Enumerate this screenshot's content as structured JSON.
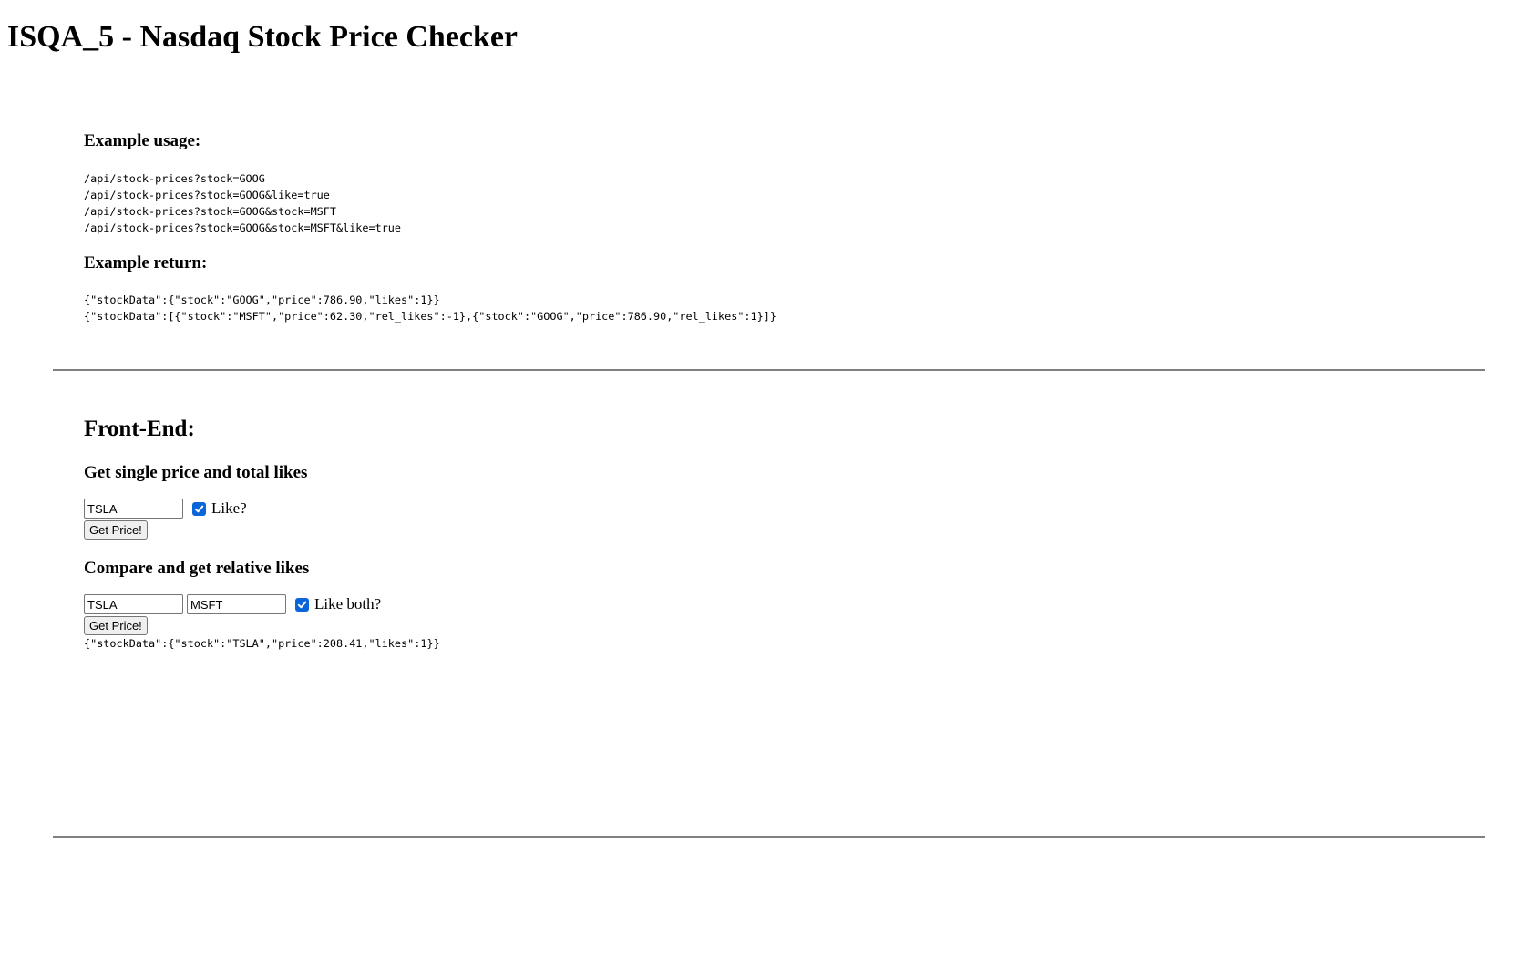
{
  "title": "ISQA_5 - Nasdaq Stock Price Checker",
  "usage": {
    "heading": "Example usage:",
    "lines": [
      "/api/stock-prices?stock=GOOG",
      "/api/stock-prices?stock=GOOG&like=true",
      "/api/stock-prices?stock=GOOG&stock=MSFT",
      "/api/stock-prices?stock=GOOG&stock=MSFT&like=true"
    ]
  },
  "return": {
    "heading": "Example return:",
    "lines": [
      "{\"stockData\":{\"stock\":\"GOOG\",\"price\":786.90,\"likes\":1}}",
      "{\"stockData\":[{\"stock\":\"MSFT\",\"price\":62.30,\"rel_likes\":-1},{\"stock\":\"GOOG\",\"price\":786.90,\"rel_likes\":1}]}"
    ]
  },
  "frontend": {
    "heading": "Front-End:",
    "single": {
      "heading": "Get single price and total likes",
      "stock_value": "TSLA",
      "like_checked": true,
      "like_label": "Like?",
      "button_label": "Get Price!"
    },
    "compare": {
      "heading": "Compare and get relative likes",
      "stock1_value": "TSLA",
      "stock2_value": "MSFT",
      "like_checked": true,
      "like_label": "Like both?",
      "button_label": "Get Price!"
    },
    "result": "{\"stockData\":{\"stock\":\"TSLA\",\"price\":208.41,\"likes\":1}}"
  },
  "colors": {
    "checkbox_accent": "#0a66d8",
    "rule": "#808080",
    "button_bg": "#efefef"
  },
  "icons": {
    "checkbox": "checkmark-icon"
  }
}
